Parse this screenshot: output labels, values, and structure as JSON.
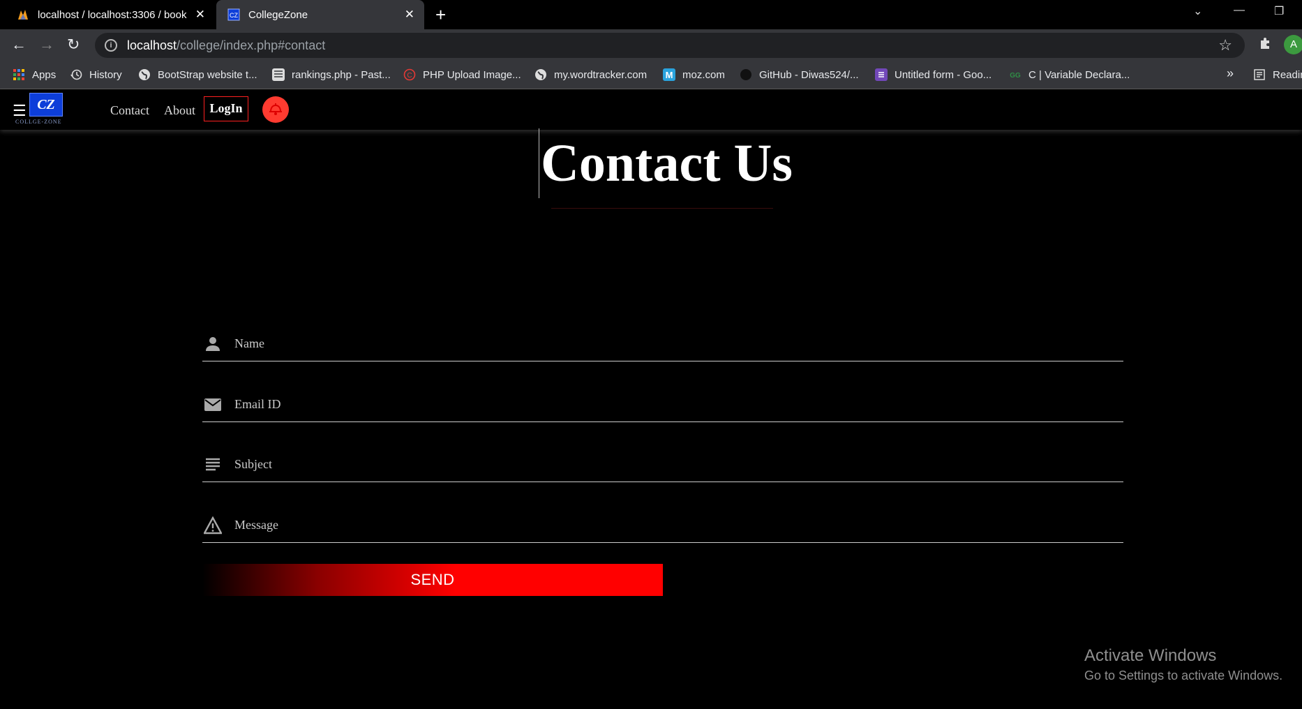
{
  "browser": {
    "tabs": [
      {
        "title": "localhost / localhost:3306 / book",
        "active": false
      },
      {
        "title": "CollegeZone",
        "active": true
      }
    ],
    "url_host": "localhost",
    "url_path": "/college/index.php#contact",
    "bookmarks": [
      {
        "label": "Apps",
        "icon": "apps-grid-icon"
      },
      {
        "label": "History",
        "icon": "history-icon"
      },
      {
        "label": "BootStrap website t...",
        "icon": "globe-icon"
      },
      {
        "label": "rankings.php - Past...",
        "icon": "pastebin-icon"
      },
      {
        "label": "PHP Upload Image...",
        "icon": "copyright-icon"
      },
      {
        "label": "my.wordtracker.com",
        "icon": "globe-icon"
      },
      {
        "label": "moz.com",
        "icon": "moz-icon"
      },
      {
        "label": "GitHub - Diwas524/...",
        "icon": "github-icon"
      },
      {
        "label": "Untitled form - Goo...",
        "icon": "google-forms-icon"
      },
      {
        "label": "C | Variable Declara...",
        "icon": "gfg-icon"
      }
    ],
    "bookmarks_overflow": "»",
    "reading_list": "Readin",
    "profile_initial": "A"
  },
  "site": {
    "logo_text": "CZ",
    "logo_subtext": "COLLGE-ZONE",
    "nav": {
      "contact": "Contact",
      "about": "About",
      "login": "LogIn"
    }
  },
  "contact": {
    "heading": "Contact Us",
    "fields": {
      "name": {
        "placeholder": "Name",
        "value": "",
        "icon": "person-icon"
      },
      "email": {
        "placeholder": "Email ID",
        "value": "",
        "icon": "mail-icon"
      },
      "subject": {
        "placeholder": "Subject",
        "value": "",
        "icon": "subject-lines-icon"
      },
      "message": {
        "placeholder": "Message",
        "value": "",
        "icon": "warning-triangle-icon"
      }
    },
    "send_label": "SEND"
  },
  "watermark": {
    "title": "Activate Windows",
    "subtitle": "Go to Settings to activate Windows."
  },
  "colors": {
    "accent": "#ff0000",
    "bell": "#ff3b30",
    "logo": "#0d3ed9"
  }
}
